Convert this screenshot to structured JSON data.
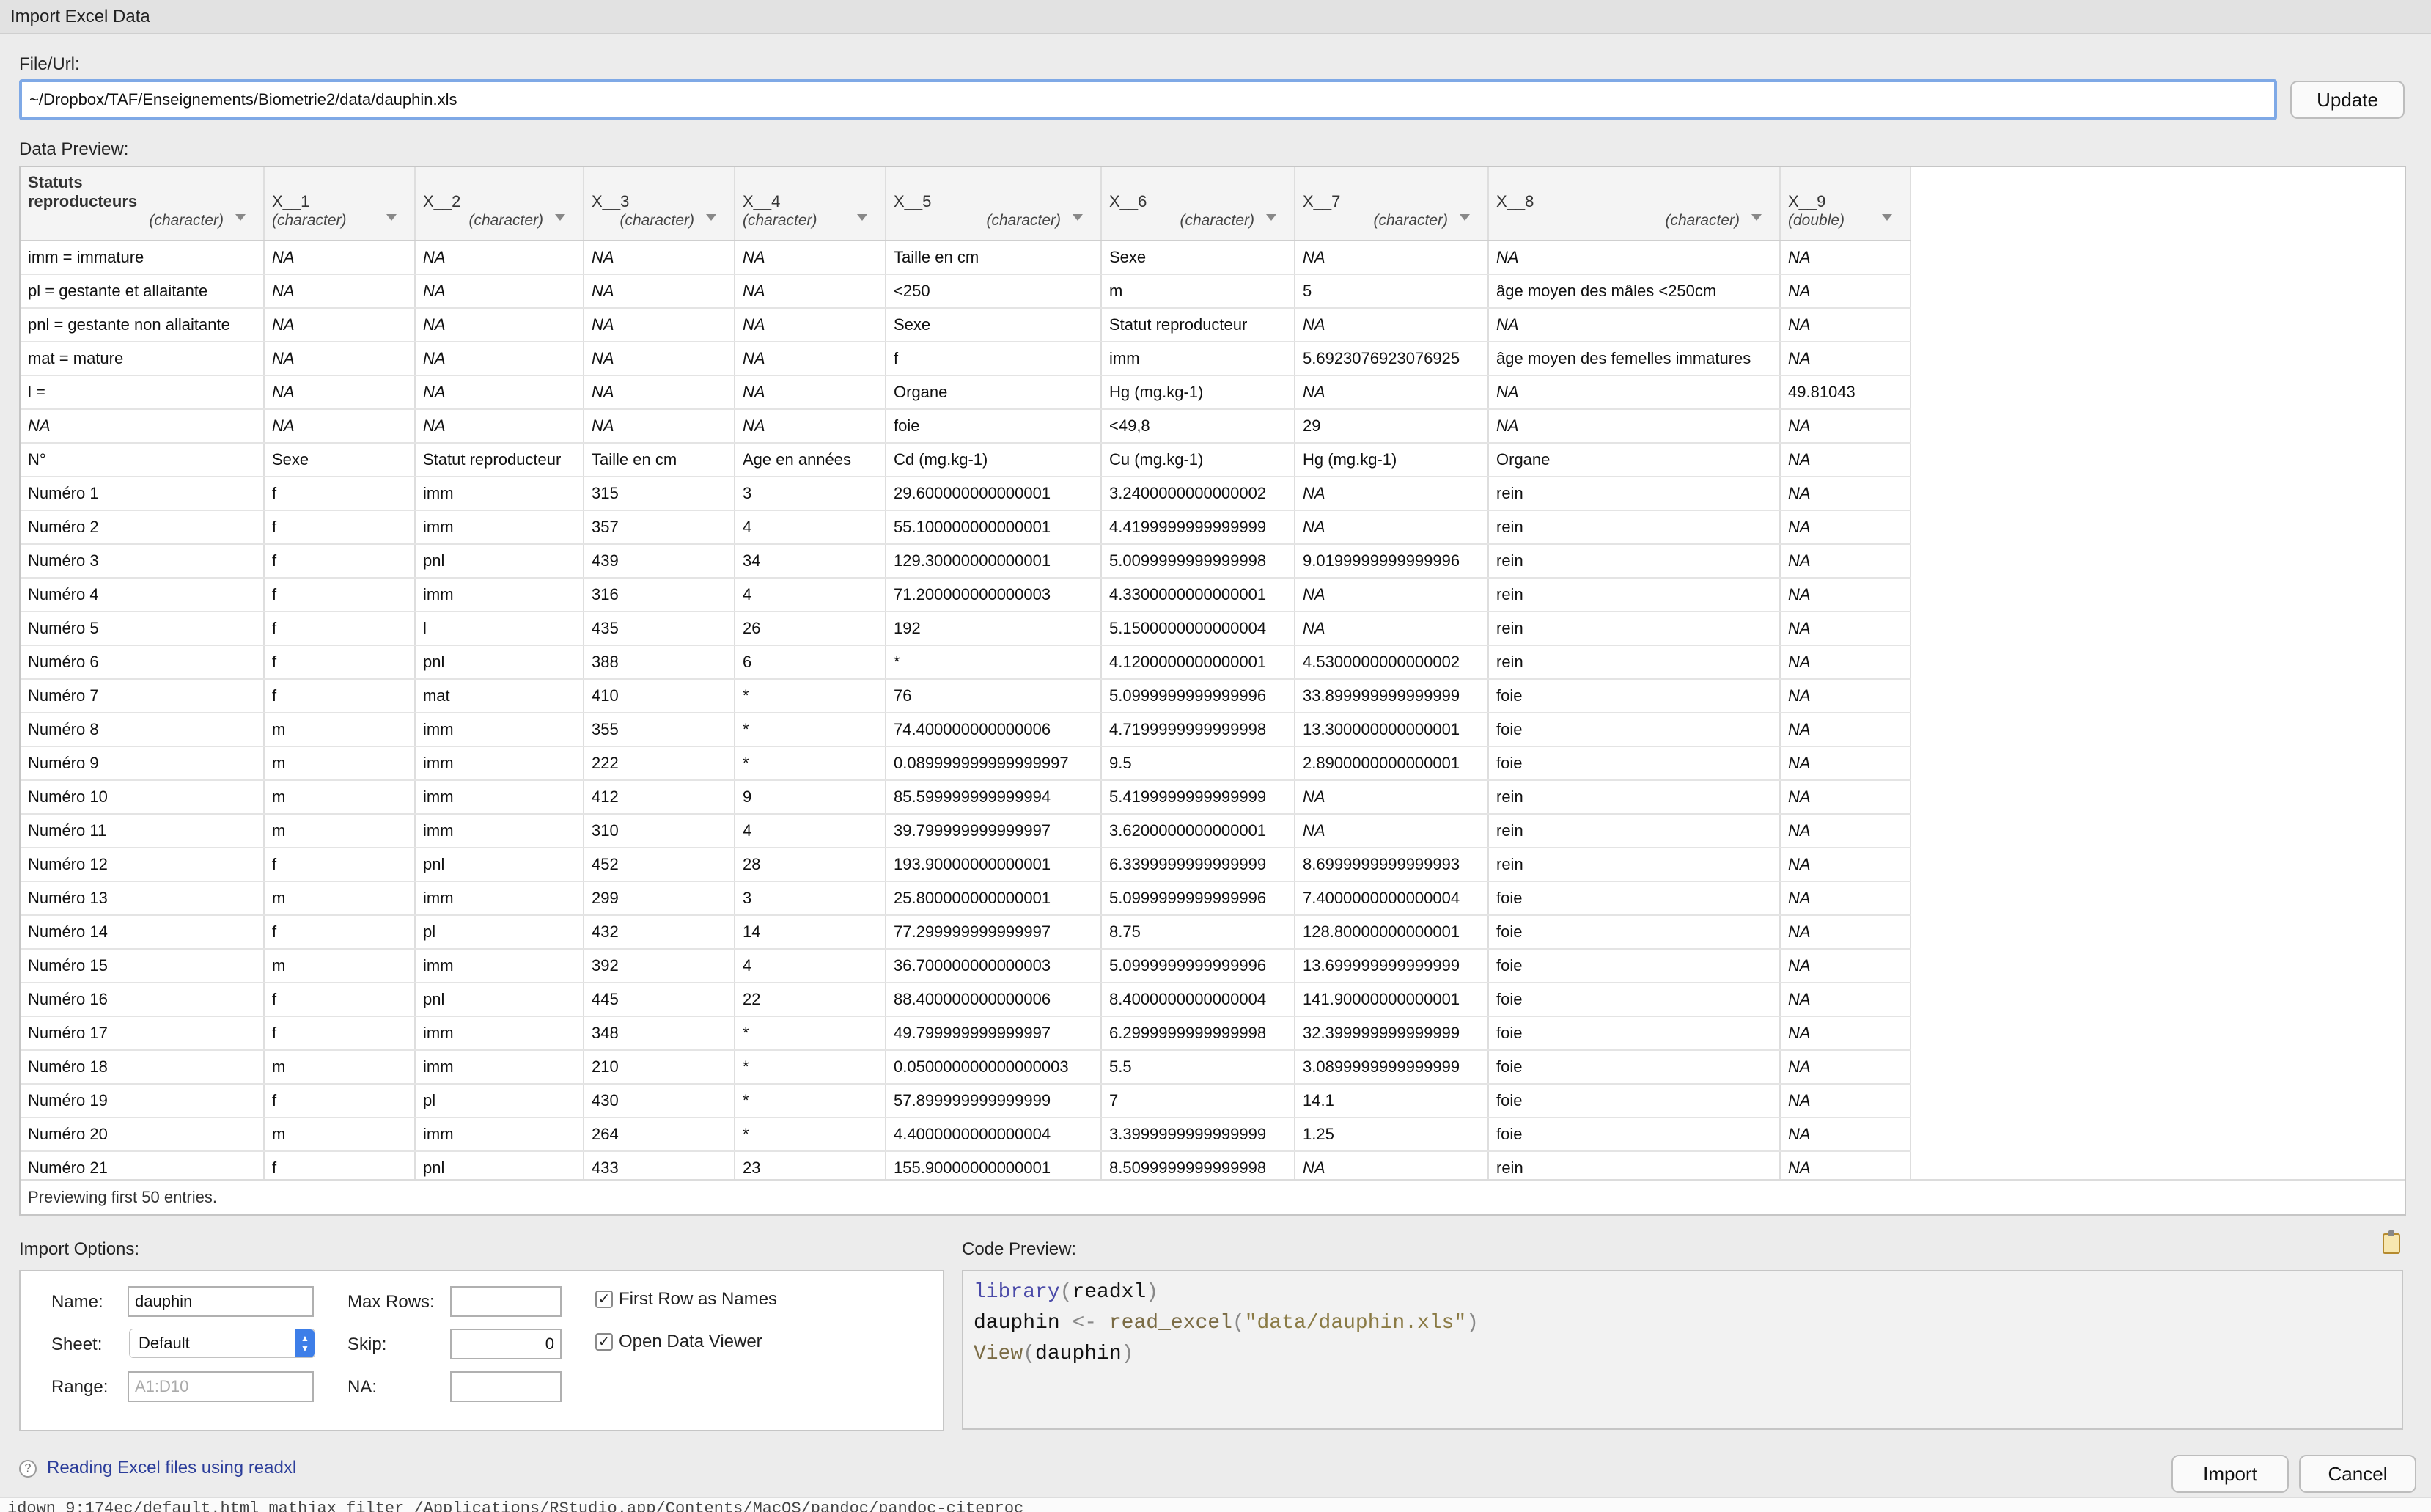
{
  "window": {
    "title": "Import Excel Data"
  },
  "file": {
    "label": "File/Url:",
    "value": "~/Dropbox/TAF/Enseignements/Biometrie2/data/dauphin.xls",
    "update_label": "Update"
  },
  "preview": {
    "label": "Data Preview:",
    "footer": "Previewing first 50 entries.",
    "columns": [
      {
        "name": "Statuts reproducteurs",
        "type": "(character)"
      },
      {
        "name": "X__1",
        "type": "(character)"
      },
      {
        "name": "X__2",
        "type": "(character)"
      },
      {
        "name": "X__3",
        "type": "(character)"
      },
      {
        "name": "X__4",
        "type": "(character)"
      },
      {
        "name": "X__5",
        "type": "(character)"
      },
      {
        "name": "X__6",
        "type": "(character)"
      },
      {
        "name": "X__7",
        "type": "(character)"
      },
      {
        "name": "X__8",
        "type": "(character)"
      },
      {
        "name": "X__9",
        "type": "(double)"
      }
    ],
    "rows": [
      [
        "imm = immature",
        "NA",
        "NA",
        "NA",
        "NA",
        "Taille en cm",
        "Sexe",
        "NA",
        "NA",
        "NA"
      ],
      [
        "pl = gestante et allaitante",
        "NA",
        "NA",
        "NA",
        "NA",
        "<250",
        "m",
        "5",
        "âge moyen des mâles <250cm",
        "NA"
      ],
      [
        "pnl = gestante non allaitante",
        "NA",
        "NA",
        "NA",
        "NA",
        "Sexe",
        "Statut reproducteur",
        "NA",
        "NA",
        "NA"
      ],
      [
        "mat = mature",
        "NA",
        "NA",
        "NA",
        "NA",
        "f",
        "imm",
        "5.6923076923076925",
        "âge moyen des femelles immatures",
        "NA"
      ],
      [
        "l =",
        "NA",
        "NA",
        "NA",
        "NA",
        "Organe",
        "Hg (mg.kg-1)",
        "NA",
        "NA",
        "49.81043"
      ],
      [
        "NA",
        "NA",
        "NA",
        "NA",
        "NA",
        "foie",
        "<49,8",
        "29",
        "NA",
        "NA"
      ],
      [
        "N°",
        "Sexe",
        "Statut reproducteur",
        "Taille en cm",
        "Age en années",
        "Cd (mg.kg-1)",
        "Cu (mg.kg-1)",
        "Hg (mg.kg-1)",
        "Organe",
        "NA"
      ],
      [
        "Numéro 1",
        "f",
        "imm",
        "315",
        "3",
        "29.600000000000001",
        "3.2400000000000002",
        "NA",
        "rein",
        "NA"
      ],
      [
        "Numéro 2",
        "f",
        "imm",
        "357",
        "4",
        "55.100000000000001",
        "4.4199999999999999",
        "NA",
        "rein",
        "NA"
      ],
      [
        "Numéro 3",
        "f",
        "pnl",
        "439",
        "34",
        "129.30000000000001",
        "5.0099999999999998",
        "9.0199999999999996",
        "rein",
        "NA"
      ],
      [
        "Numéro 4",
        "f",
        "imm",
        "316",
        "4",
        "71.200000000000003",
        "4.3300000000000001",
        "NA",
        "rein",
        "NA"
      ],
      [
        "Numéro 5",
        "f",
        "l",
        "435",
        "26",
        "192",
        "5.1500000000000004",
        "NA",
        "rein",
        "NA"
      ],
      [
        "Numéro 6",
        "f",
        "pnl",
        "388",
        "6",
        "*",
        "4.1200000000000001",
        "4.5300000000000002",
        "rein",
        "NA"
      ],
      [
        "Numéro 7",
        "f",
        "mat",
        "410",
        "*",
        "76",
        "5.0999999999999996",
        "33.899999999999999",
        "foie",
        "NA"
      ],
      [
        "Numéro 8",
        "m",
        "imm",
        "355",
        "*",
        "74.400000000000006",
        "4.7199999999999998",
        "13.300000000000001",
        "foie",
        "NA"
      ],
      [
        "Numéro 9",
        "m",
        "imm",
        "222",
        "*",
        "0.089999999999999997",
        "9.5",
        "2.8900000000000001",
        "foie",
        "NA"
      ],
      [
        "Numéro 10",
        "m",
        "imm",
        "412",
        "9",
        "85.599999999999994",
        "5.4199999999999999",
        "NA",
        "rein",
        "NA"
      ],
      [
        "Numéro 11",
        "m",
        "imm",
        "310",
        "4",
        "39.799999999999997",
        "3.6200000000000001",
        "NA",
        "rein",
        "NA"
      ],
      [
        "Numéro 12",
        "f",
        "pnl",
        "452",
        "28",
        "193.90000000000001",
        "6.3399999999999999",
        "8.6999999999999993",
        "rein",
        "NA"
      ],
      [
        "Numéro 13",
        "m",
        "imm",
        "299",
        "3",
        "25.800000000000001",
        "5.0999999999999996",
        "7.4000000000000004",
        "foie",
        "NA"
      ],
      [
        "Numéro 14",
        "f",
        "pl",
        "432",
        "14",
        "77.299999999999997",
        "8.75",
        "128.80000000000001",
        "foie",
        "NA"
      ],
      [
        "Numéro 15",
        "m",
        "imm",
        "392",
        "4",
        "36.700000000000003",
        "5.0999999999999996",
        "13.699999999999999",
        "foie",
        "NA"
      ],
      [
        "Numéro 16",
        "f",
        "pnl",
        "445",
        "22",
        "88.400000000000006",
        "8.4000000000000004",
        "141.90000000000001",
        "foie",
        "NA"
      ],
      [
        "Numéro 17",
        "f",
        "imm",
        "348",
        "*",
        "49.799999999999997",
        "6.2999999999999998",
        "32.399999999999999",
        "foie",
        "NA"
      ],
      [
        "Numéro 18",
        "m",
        "imm",
        "210",
        "*",
        "0.050000000000000003",
        "5.5",
        "3.0899999999999999",
        "foie",
        "NA"
      ],
      [
        "Numéro 19",
        "f",
        "pl",
        "430",
        "*",
        "57.899999999999999",
        "7",
        "14.1",
        "foie",
        "NA"
      ],
      [
        "Numéro 20",
        "m",
        "imm",
        "264",
        "*",
        "4.4000000000000004",
        "3.3999999999999999",
        "1.25",
        "foie",
        "NA"
      ],
      [
        "Numéro 21",
        "f",
        "pnl",
        "433",
        "23",
        "155.90000000000001",
        "8.5099999999999998",
        "NA",
        "rein",
        "NA"
      ]
    ]
  },
  "import_options": {
    "label": "Import Options:",
    "name_label": "Name:",
    "name_value": "dauphin",
    "sheet_label": "Sheet:",
    "sheet_value": "Default",
    "range_label": "Range:",
    "range_placeholder": "A1:D10",
    "max_rows_label": "Max Rows:",
    "max_rows_value": "",
    "skip_label": "Skip:",
    "skip_value": "0",
    "na_label": "NA:",
    "na_value": "",
    "first_row_label": "First Row as Names",
    "first_row_checked": true,
    "open_viewer_label": "Open Data Viewer",
    "open_viewer_checked": true
  },
  "code_preview": {
    "label": "Code Preview:",
    "line1_fn": "library",
    "line1_arg": "readxl",
    "line2_var": "dauphin",
    "line2_op": "<-",
    "line2_fn": "read_excel",
    "line2_str": "\"data/dauphin.xls\"",
    "line3_fn": "View",
    "line3_arg": "dauphin"
  },
  "help": {
    "link_text": "Reading Excel files using readxl"
  },
  "actions": {
    "import_label": "Import",
    "cancel_label": "Cancel"
  },
  "background_console": "idown 9:174ec/default.html  mathjax  filter /Applications/RStudio.app/Contents/MacOS/pandoc/pandoc-citeproc"
}
